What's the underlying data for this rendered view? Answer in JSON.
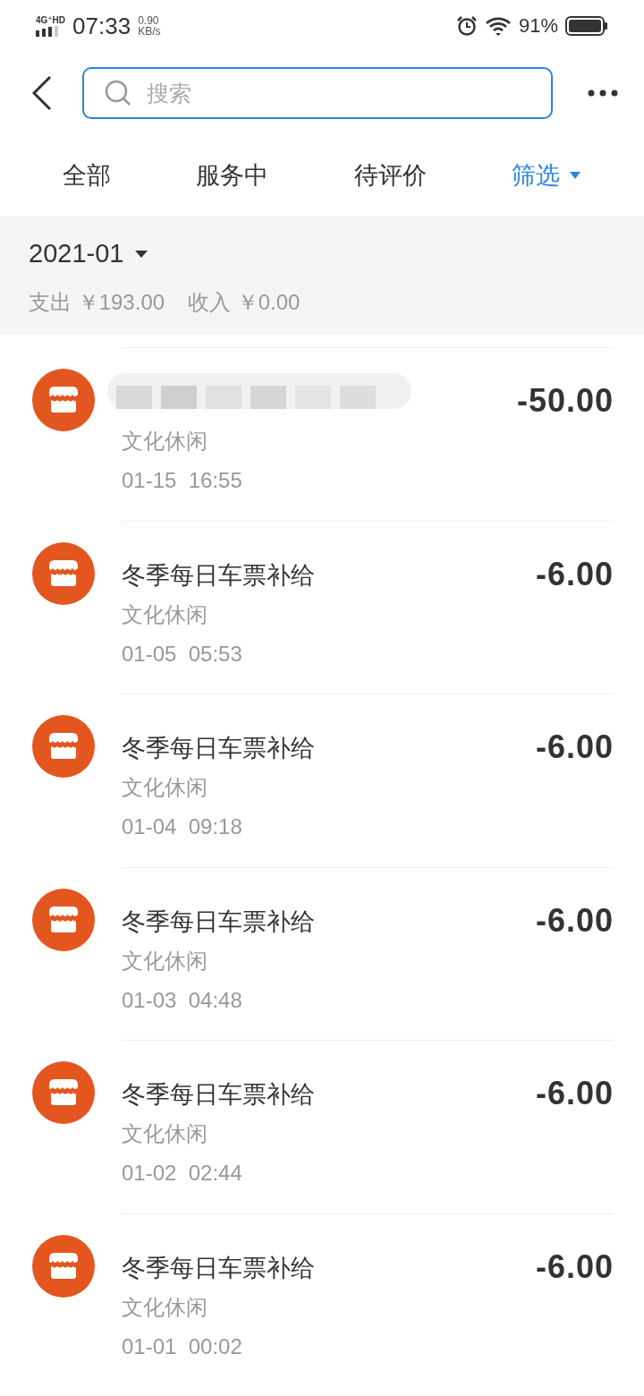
{
  "status_bar": {
    "network": "4G⁺HD",
    "time": "07:33",
    "speed_value": "0.90",
    "speed_unit": "KB/s",
    "battery": "91%"
  },
  "search": {
    "placeholder": "搜索"
  },
  "tabs": [
    {
      "label": "全部",
      "selected": false,
      "dropdown": false
    },
    {
      "label": "服务中",
      "selected": false,
      "dropdown": false
    },
    {
      "label": "待评价",
      "selected": false,
      "dropdown": false
    },
    {
      "label": "筛选",
      "selected": true,
      "dropdown": true
    }
  ],
  "month": {
    "label": "2021-01",
    "expense": "支出 ￥193.00",
    "income": "收入 ￥0.00"
  },
  "transactions": [
    {
      "redacted": true,
      "category": "文化休闲",
      "time": "01-15  16:55",
      "amount": "-50.00"
    },
    {
      "title": "冬季每日车票补给",
      "category": "文化休闲",
      "time": "01-05  05:53",
      "amount": "-6.00"
    },
    {
      "title": "冬季每日车票补给",
      "category": "文化休闲",
      "time": "01-04  09:18",
      "amount": "-6.00"
    },
    {
      "title": "冬季每日车票补给",
      "category": "文化休闲",
      "time": "01-03  04:48",
      "amount": "-6.00"
    },
    {
      "title": "冬季每日车票补给",
      "category": "文化休闲",
      "time": "01-02  02:44",
      "amount": "-6.00"
    },
    {
      "title": "冬季每日车票补给",
      "category": "文化休闲",
      "time": "01-01  00:02",
      "amount": "-6.00"
    }
  ]
}
